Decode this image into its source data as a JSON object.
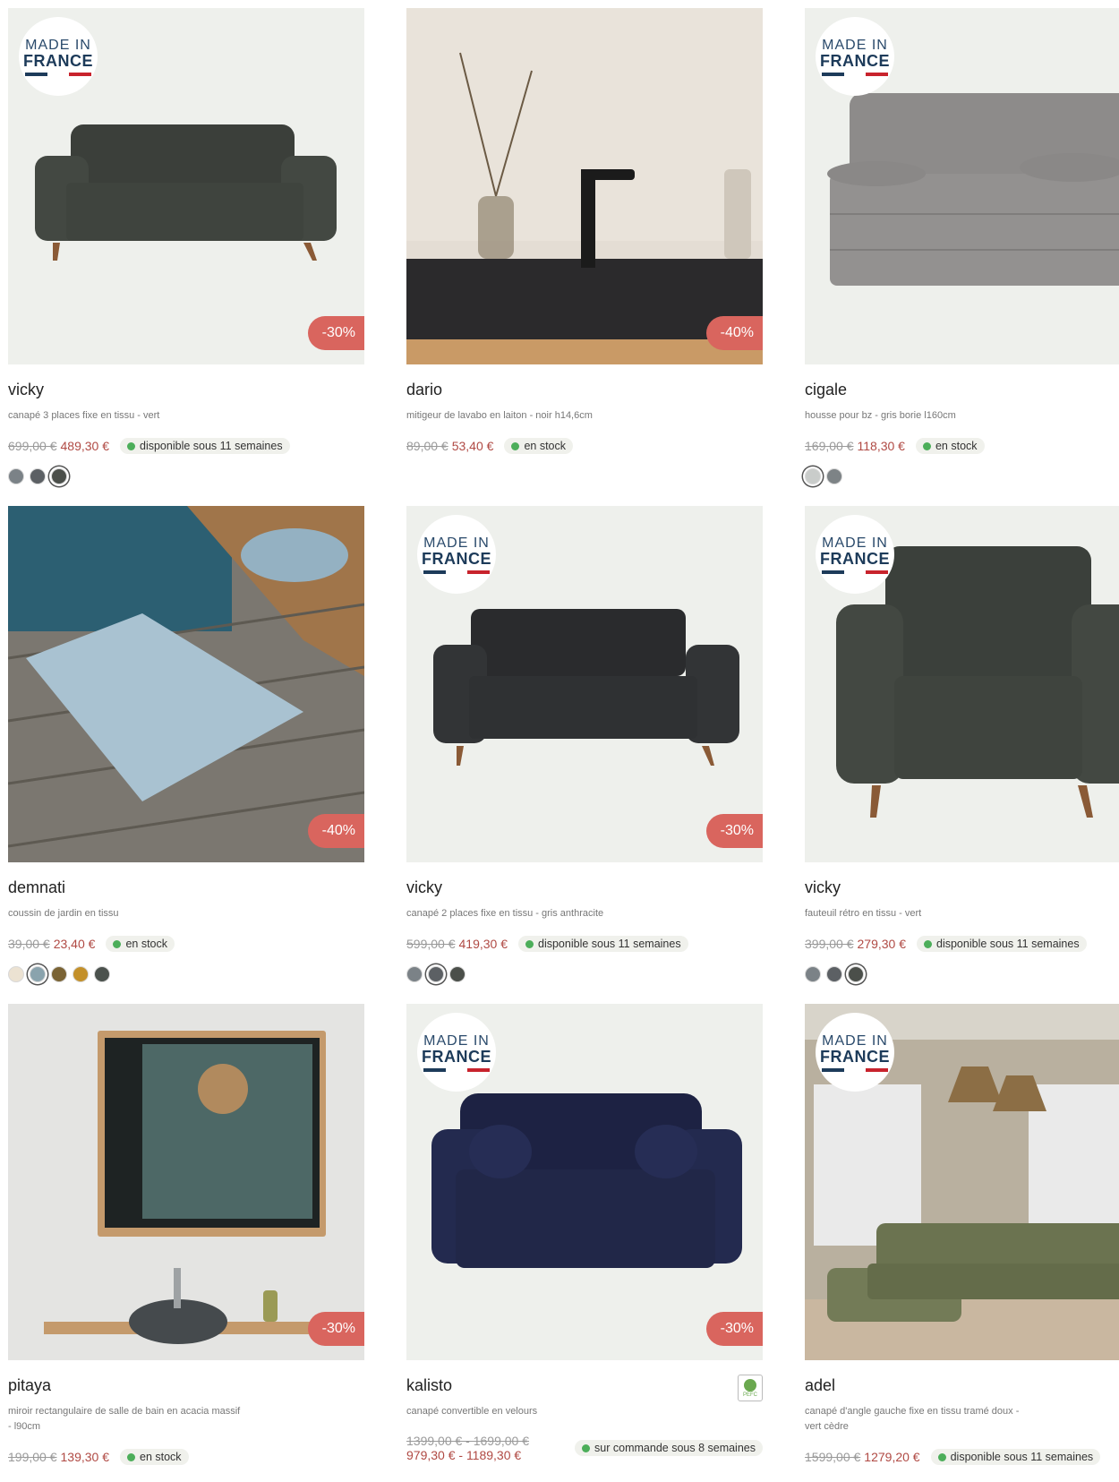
{
  "colors": {
    "discount_badge": "#d9655e",
    "price_new": "#b04a44",
    "stock_dot": "#4cae5a",
    "flag_blue": "#1d3b5a",
    "flag_red": "#c8232c"
  },
  "badge": {
    "line1": "MADE IN",
    "line2": "FRANCE"
  },
  "products": [
    {
      "name": "vicky",
      "desc": "canapé 3 places fixe en tissu - vert",
      "old_price": "699,00 €",
      "new_price": "489,30 €",
      "availability": "disponible sous 11 semaines",
      "discount": "-30%",
      "image": "green-sofa-3-places",
      "made_in_france": true,
      "swatches": [
        "#7b8287",
        "#5c6064",
        "#4b4f4a"
      ],
      "selected_swatch": 2
    },
    {
      "name": "dario",
      "desc": "mitigeur de lavabo en laiton - noir h14,6cm",
      "old_price": "89,00 €",
      "new_price": "53,40 €",
      "availability": "en stock",
      "discount": "-40%",
      "image": "black-faucet",
      "made_in_france": false,
      "swatches": []
    },
    {
      "name": "cigale",
      "desc": "housse pour bz - gris borie l160cm",
      "old_price": "169,00 €",
      "new_price": "118,30 €",
      "availability": "en stock",
      "discount": "",
      "image": "grey-bz-cover",
      "made_in_france": true,
      "swatches": [
        "#c9ccca",
        "#7d8386"
      ],
      "selected_swatch": 0
    },
    {
      "name": "demnati",
      "desc": "coussin de jardin en tissu",
      "old_price": "39,00 €",
      "new_price": "23,40 €",
      "availability": "en stock",
      "discount": "-40%",
      "image": "blue-garden-cushion",
      "made_in_france": false,
      "swatches": [
        "#ece2d2",
        "#8aa3ad",
        "#7a6334",
        "#c3902a",
        "#4b524d"
      ],
      "selected_swatch": 1
    },
    {
      "name": "vicky",
      "desc": "canapé 2 places fixe en tissu - gris anthracite",
      "old_price": "599,00 €",
      "new_price": "419,30 €",
      "availability": "disponible sous 11 semaines",
      "discount": "-30%",
      "image": "anthracite-sofa-2-places",
      "made_in_france": true,
      "swatches": [
        "#7b8287",
        "#5c6064",
        "#4b4f4a"
      ],
      "selected_swatch": 1
    },
    {
      "name": "vicky",
      "desc": "fauteuil rétro en tissu - vert",
      "old_price": "399,00 €",
      "new_price": "279,30 €",
      "availability": "disponible sous 11 semaines",
      "discount": "",
      "image": "green-armchair",
      "made_in_france": true,
      "swatches": [
        "#7b8287",
        "#5c6064",
        "#4b4f4a"
      ],
      "selected_swatch": 2
    },
    {
      "name": "pitaya",
      "desc": "miroir rectangulaire de salle de bain en acacia massif - l90cm",
      "old_price": "199,00 €",
      "new_price": "139,30 €",
      "availability": "en stock",
      "discount": "-30%",
      "image": "bathroom-mirror",
      "made_in_france": false,
      "swatches": []
    },
    {
      "name": "kalisto",
      "desc": "canapé convertible en velours",
      "old_price": "1399,00 € - 1699,00 €",
      "new_price": "979,30 € - 1189,30 €",
      "availability": "sur commande sous 8 semaines",
      "discount": "-30%",
      "image": "navy-velvet-sofa",
      "made_in_france": true,
      "pefc": "PEFC",
      "swatches": []
    },
    {
      "name": "adel",
      "desc": "canapé d'angle gauche fixe en tissu tramé doux - vert cèdre",
      "old_price": "1599,00 €",
      "new_price": "1279,20 €",
      "availability": "disponible sous 11 semaines",
      "discount": "",
      "image": "green-corner-sofa",
      "made_in_france": true,
      "swatches": []
    }
  ]
}
